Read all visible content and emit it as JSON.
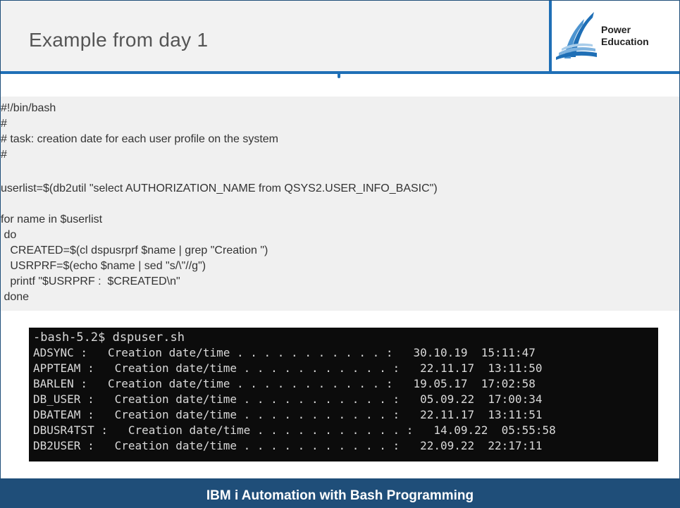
{
  "slide": {
    "title": "Example from day 1",
    "logo": {
      "line1": "Power",
      "line2": "Education",
      "icon": "power-education-logo-icon"
    },
    "footer": "IBM i Automation with Bash Programming",
    "colors": {
      "header_bg": "#f2f2f2",
      "accent": "#1f6fb6",
      "footer_bg": "#1f4e79",
      "code_bg": "#f0f0f0",
      "terminal_bg": "#0c0c0c"
    }
  },
  "script_lines": [
    "#!/bin/bash",
    "#",
    "# task: creation date for each user profile on the system",
    "#",
    "",
    "userlist=$(db2util \"select AUTHORIZATION_NAME from QSYS2.USER_INFO_BASIC\")",
    "",
    "for name in $userlist",
    " do",
    "   CREATED=$(cl dspusrprf $name | grep \"Creation \")",
    "   USRPRF=$(echo $name | sed \"s/\\\"//g\")",
    "   printf \"$USRPRF :  $CREATED\\n\"",
    " done"
  ],
  "terminal": {
    "prompt": "-bash-5.2$ dspuser.sh",
    "lines": [
      "ADSYNC :   Creation date/time . . . . . . . . . . . :   30.10.19  15:11:47",
      "APPTEAM :   Creation date/time . . . . . . . . . . . :   22.11.17  13:11:50",
      "BARLEN :   Creation date/time . . . . . . . . . . . :   19.05.17  17:02:58",
      "DB_USER :   Creation date/time . . . . . . . . . . . :   05.09.22  17:00:34",
      "DBATEAM :   Creation date/time . . . . . . . . . . . :   22.11.17  13:11:51",
      "DBUSR4TST :   Creation date/time . . . . . . . . . . . :   14.09.22  05:55:58",
      "DB2USER :   Creation date/time . . . . . . . . . . . :   22.09.22  22:17:11"
    ]
  }
}
